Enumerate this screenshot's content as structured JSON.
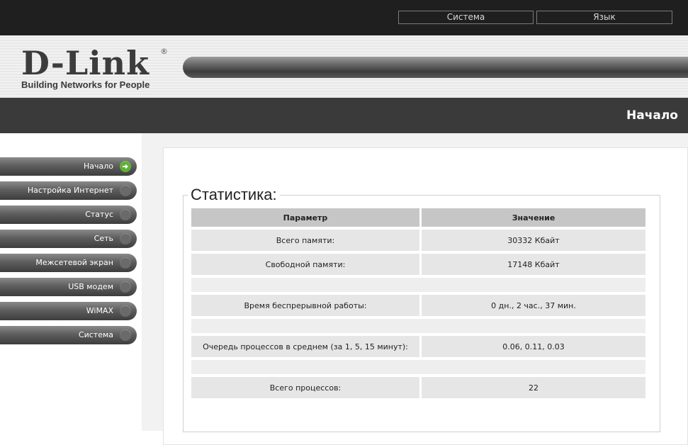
{
  "topnav": {
    "system": "Система",
    "language": "Язык"
  },
  "logo": {
    "brand": "D-Link",
    "registered": "®",
    "tagline": "Building Networks for People"
  },
  "page_title": "Начало",
  "sidebar": {
    "items": [
      {
        "label": "Начало",
        "active": true
      },
      {
        "label": "Настройка Интернет",
        "active": false
      },
      {
        "label": "Статус",
        "active": false
      },
      {
        "label": "Сеть",
        "active": false
      },
      {
        "label": "Межсетевой экран",
        "active": false
      },
      {
        "label": "USB модем",
        "active": false
      },
      {
        "label": "WiMAX",
        "active": false
      },
      {
        "label": "Система",
        "active": false
      }
    ]
  },
  "stats": {
    "legend": "Статистика:",
    "headers": {
      "param": "Параметр",
      "value": "Значение"
    },
    "rows": [
      {
        "param": "Всего памяти:",
        "value": "30332 Кбайт"
      },
      {
        "param": "Свободной памяти:",
        "value": "17148 Кбайт"
      },
      {
        "param": "",
        "value": ""
      },
      {
        "param": "Время беспрерывной работы:",
        "value": "0 дн., 2 час., 37 мин."
      },
      {
        "param": "",
        "value": ""
      },
      {
        "param": "Очередь процессов в среднем (за 1, 5, 15 минут):",
        "value": "0.06, 0.11, 0.03"
      },
      {
        "param": "",
        "value": ""
      },
      {
        "param": "Всего процессов:",
        "value": "22"
      }
    ]
  },
  "colors": {
    "active_indicator": "#5fb035",
    "topbar": "#1f1f1f",
    "titlebar": "#3a3a3a"
  }
}
